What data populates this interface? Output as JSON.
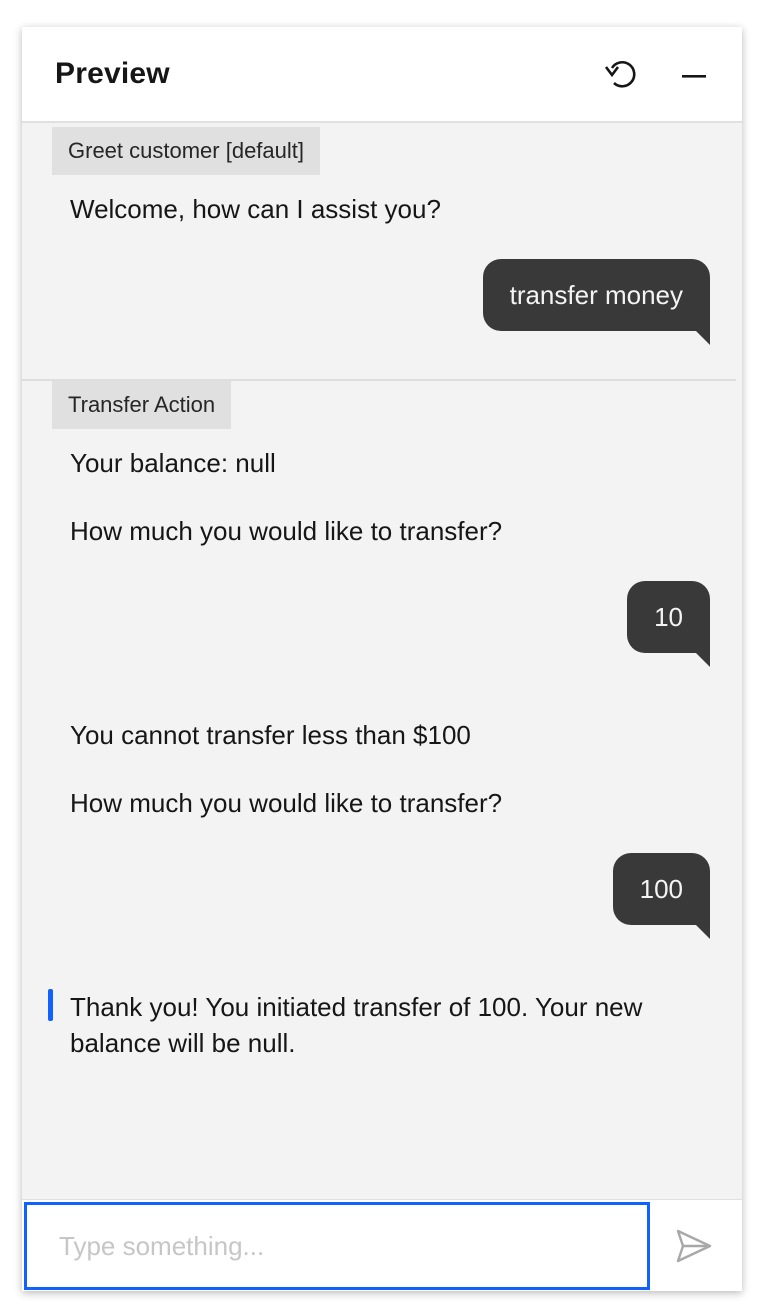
{
  "header": {
    "title": "Preview",
    "reset_icon": "reset-icon",
    "minimize_icon": "minimize-icon"
  },
  "sections": [
    {
      "tag": "Greet customer [default]",
      "messages": [
        "Welcome, how can I assist you?"
      ],
      "user_reply": "transfer money"
    },
    {
      "tag": "Transfer Action",
      "messages": [
        "Your balance: null",
        "How much you would like to transfer?"
      ],
      "user_reply_1": "10",
      "messages_2": [
        "You cannot transfer less than $100",
        "How much you would like to transfer?"
      ],
      "user_reply_2": "100",
      "final_message": "Thank you! You initiated transfer of 100. Your new balance will be null."
    }
  ],
  "composer": {
    "placeholder": "Type something...",
    "send_icon": "send-icon"
  },
  "colors": {
    "accent": "#0f62fe",
    "user_bubble": "#393939",
    "panel_bg": "#f3f3f3",
    "tag_bg": "#e0e0e0"
  }
}
